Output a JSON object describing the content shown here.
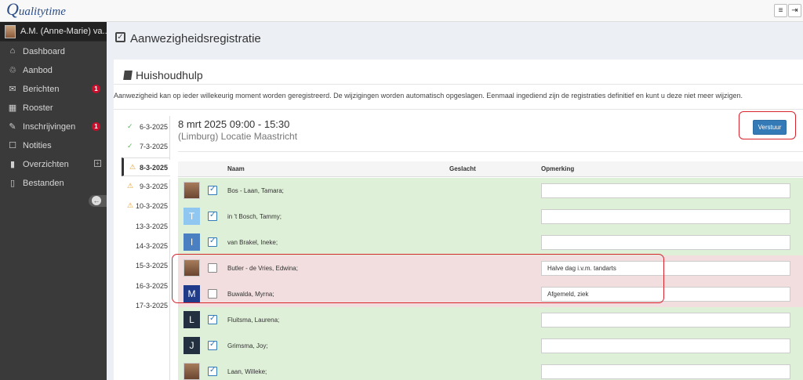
{
  "app": {
    "logo_initial": "Q",
    "logo_rest": "ualitytime",
    "menu_icon": "hamburger-icon",
    "logout_icon": "logout-icon"
  },
  "sidebar": {
    "user_name": "A.M. (Anne-Marie) va...",
    "items": [
      {
        "icon": "home-icon",
        "glyph": "⌂",
        "label": "Dashboard"
      },
      {
        "icon": "bicycle-icon",
        "glyph": "♲",
        "label": "Aanbod"
      },
      {
        "icon": "chat-icon",
        "glyph": "✉",
        "label": "Berichten",
        "badge": "1"
      },
      {
        "icon": "calendar-icon",
        "glyph": "▦",
        "label": "Rooster"
      },
      {
        "icon": "edit-icon",
        "glyph": "✎",
        "label": "Inschrijvingen",
        "badge": "1"
      },
      {
        "icon": "note-icon",
        "glyph": "☐",
        "label": "Notities"
      },
      {
        "icon": "bar-chart-icon",
        "glyph": "▮",
        "label": "Overzichten",
        "expand": "+"
      },
      {
        "icon": "file-icon",
        "glyph": "▯",
        "label": "Bestanden"
      }
    ],
    "collapse_glyph": "←"
  },
  "page": {
    "title": "Aanwezigheidsregistratie",
    "title_check": "✓"
  },
  "panel": {
    "title": "Huishoudhulp",
    "info": "Aanwezigheid kan op ieder willekeurig moment worden geregistreerd. De wijzigingen worden automatisch opgeslagen. Eenmaal ingediend zijn de registraties definitief en kunt u deze niet meer wijzigen."
  },
  "dates": [
    {
      "label": "6-3-2025",
      "status": "done"
    },
    {
      "label": "7-3-2025",
      "status": "done"
    },
    {
      "label": "8-3-2025",
      "status": "warn",
      "active": true
    },
    {
      "label": "9-3-2025",
      "status": "warn"
    },
    {
      "label": "10-3-2025",
      "status": "warn"
    },
    {
      "label": "13-3-2025",
      "status": "none"
    },
    {
      "label": "14-3-2025",
      "status": "none"
    },
    {
      "label": "15-3-2025",
      "status": "none"
    },
    {
      "label": "16-3-2025",
      "status": "none"
    },
    {
      "label": "17-3-2025",
      "status": "none"
    }
  ],
  "session": {
    "datetime": "8 mrt 2025 09:00 - 15:30",
    "location": "(Limburg) Locatie Maastricht",
    "submit_label": "Verstuur"
  },
  "table": {
    "headers": {
      "name": "Naam",
      "gender": "Geslacht",
      "remark": "Opmerking"
    },
    "rows": [
      {
        "name": "Bos - Laan, Tamara;",
        "avatar": "photo",
        "checked": true,
        "remark": "",
        "state": "green"
      },
      {
        "name": "in 't Bosch, Tammy;",
        "avatar": "T",
        "avatar_color": "#8fc7f0",
        "checked": true,
        "remark": "",
        "state": "green"
      },
      {
        "name": "van Brakel, Ineke;",
        "avatar": "I",
        "avatar_color": "#4a7fc1",
        "checked": true,
        "remark": "",
        "state": "green"
      },
      {
        "name": "Butler - de Vries, Edwina;",
        "avatar": "photo",
        "checked": false,
        "remark": "Halve dag i.v.m. tandarts",
        "state": "red"
      },
      {
        "name": "Buwalda, Myrna;",
        "avatar": "M",
        "avatar_color": "#1f3b8a",
        "checked": false,
        "remark": "Afgemeld, ziek",
        "state": "red"
      },
      {
        "name": "Fluitsma, Laurena;",
        "avatar": "L",
        "avatar_color": "#22303f",
        "checked": true,
        "remark": "",
        "state": "green"
      },
      {
        "name": "Grimsma, Joy;",
        "avatar": "J",
        "avatar_color": "#22303f",
        "checked": true,
        "remark": "",
        "state": "green"
      },
      {
        "name": "Laan, Willeke;",
        "avatar": "photo",
        "checked": true,
        "remark": "",
        "state": "green"
      }
    ]
  }
}
